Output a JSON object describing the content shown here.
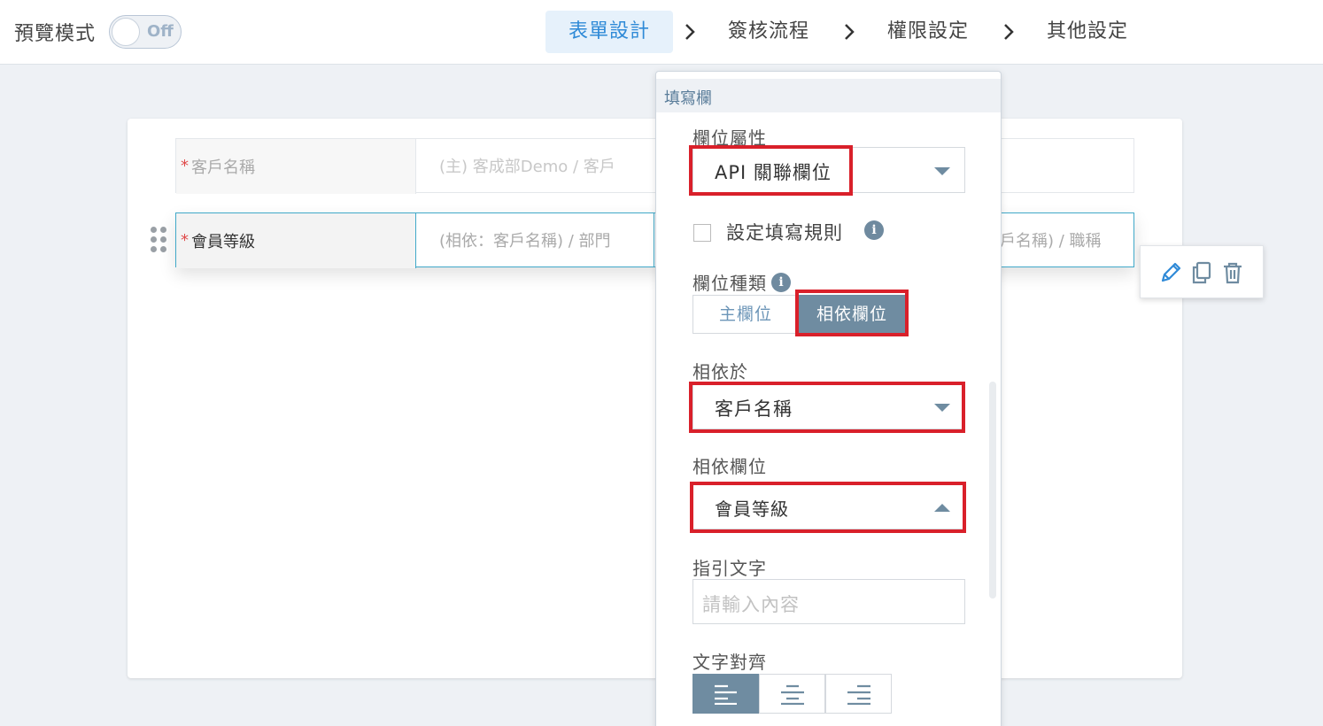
{
  "topbar": {
    "preview_label": "預覽模式",
    "toggle_text": "Off",
    "steps": [
      "表單設計",
      "簽核流程",
      "權限設定",
      "其他設定"
    ]
  },
  "form": {
    "rows": [
      {
        "label": "客戶名稱",
        "value_placeholder": "(主) 客成部Demo / 客戶",
        "extra_placeholder": ""
      },
      {
        "label": "會員等級",
        "value_placeholder": "(相依：客戶名稱) / 部門",
        "extra_placeholder": "戶名稱) / 職稱"
      }
    ]
  },
  "panel": {
    "header": "填寫欄",
    "field_property_label": "欄位屬性",
    "field_property_value": "API 關聯欄位",
    "rule_checkbox_label": "設定填寫規則",
    "field_type_label": "欄位種類",
    "field_type_options": [
      "主欄位",
      "相依欄位"
    ],
    "depends_on_label": "相依於",
    "depends_on_value": "客戶名稱",
    "dependent_field_label": "相依欄位",
    "dependent_field_value": "會員等級",
    "hint_label": "指引文字",
    "hint_placeholder": "請輸入內容",
    "text_align_label": "文字對齊"
  },
  "colors": {
    "accent_blue": "#2f8ad7",
    "highlight_red": "#d9202a",
    "segment_active": "#6f8ca1",
    "row_border_active": "#41a9c9"
  },
  "icons": {
    "info": "info-icon",
    "edit": "pencil-icon",
    "copy": "copy-icon",
    "delete": "trash-icon",
    "drag": "drag-handle-icon"
  }
}
